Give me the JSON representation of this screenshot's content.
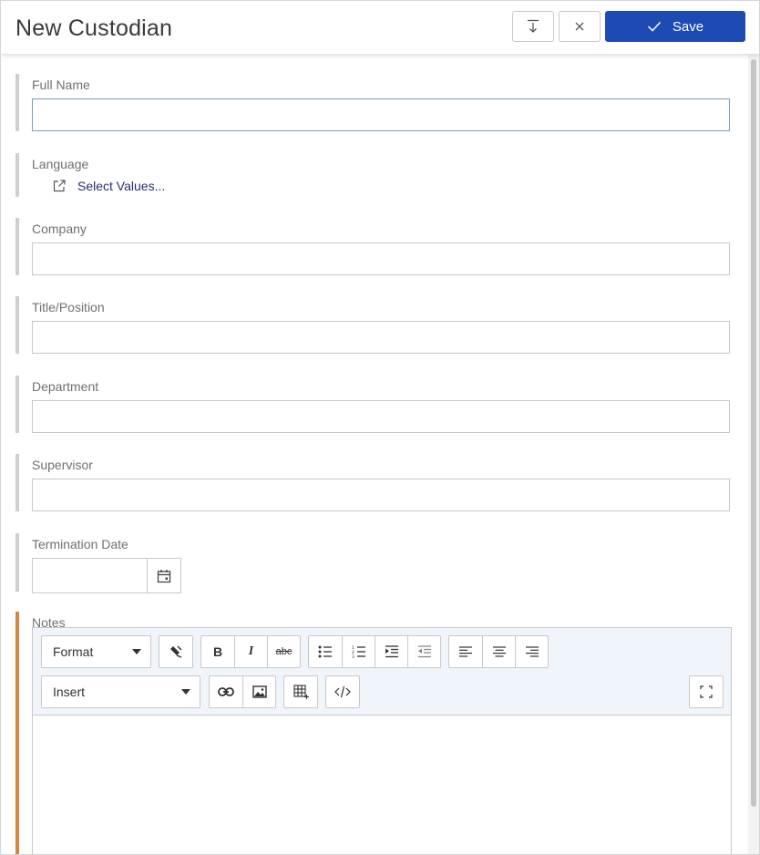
{
  "header": {
    "title": "New Custodian",
    "save_label": "Save",
    "accent": "#1e4bb3"
  },
  "form": {
    "full_name": {
      "label": "Full Name",
      "value": ""
    },
    "language": {
      "label": "Language",
      "link": "Select Values..."
    },
    "company": {
      "label": "Company",
      "value": ""
    },
    "title_position": {
      "label": "Title/Position",
      "value": ""
    },
    "department": {
      "label": "Department",
      "value": ""
    },
    "supervisor": {
      "label": "Supervisor",
      "value": ""
    },
    "termination_date": {
      "label": "Termination Date",
      "value": ""
    },
    "notes": {
      "label": "Notes",
      "accent": "#d4873e",
      "format_dropdown": "Format",
      "insert_dropdown": "Insert",
      "bold": "B",
      "italic": "I",
      "strike": "abc"
    }
  }
}
